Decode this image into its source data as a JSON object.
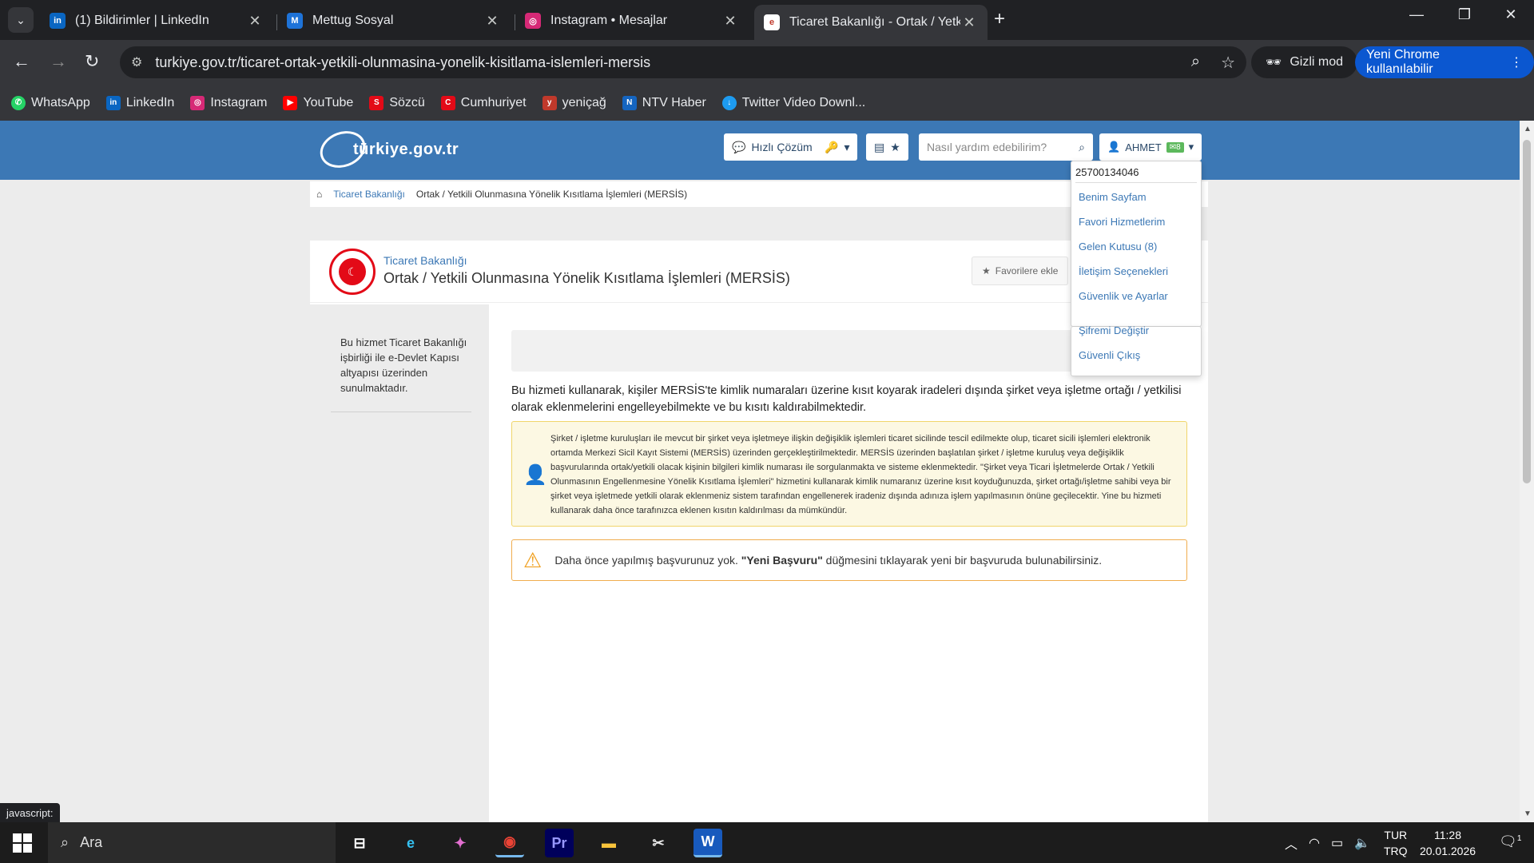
{
  "tabs": [
    {
      "title": "(1) Bildirimler | LinkedIn",
      "icon": "linkedin-icon",
      "color": "#0a66c2"
    },
    {
      "title": "Mettug Sosyal",
      "icon": "mettug-icon",
      "color": "#1e73d8"
    },
    {
      "title": "Instagram • Mesajlar",
      "icon": "instagram-icon",
      "color": "#d62976"
    },
    {
      "title": "Ticaret Bakanlığı - Ortak / Yetkil",
      "icon": "turkiye-gov-icon",
      "color": "#c0392b"
    }
  ],
  "address_bar": {
    "url": "turkiye.gov.tr/ticaret-ortak-yetkili-olunmasina-yonelik-kisitlama-islemleri-mersis"
  },
  "incognito_label": "Gizli mod",
  "new_chrome_label": "Yeni Chrome kullanılabilir",
  "bookmarks": [
    {
      "label": "WhatsApp",
      "color": "#25d366"
    },
    {
      "label": "LinkedIn",
      "color": "#0a66c2"
    },
    {
      "label": "Instagram",
      "color": "#d62976"
    },
    {
      "label": "YouTube",
      "color": "#ff0000"
    },
    {
      "label": "Sözcü",
      "color": "#e30a17"
    },
    {
      "label": "Cumhuriyet",
      "color": "#e30a17"
    },
    {
      "label": "yeniçağ",
      "color": "#c0392b"
    },
    {
      "label": "NTV Haber",
      "color": "#1565c0"
    },
    {
      "label": "Twitter Video Downl...",
      "color": "#1d9bf0"
    }
  ],
  "site": {
    "logo_text": "türkiye.gov.tr",
    "quick_solution": "Hızlı Çözüm",
    "search_placeholder": "Nasıl yardım edebilirim?",
    "user_name": "AHMET",
    "mail_count": "8"
  },
  "breadcrumb": {
    "home": "home",
    "items": [
      "Ticaret Bakanlığı",
      "Ortak / Yetkili Olunmasına Yönelik Kısıtlama İşlemleri (MERSİS)"
    ]
  },
  "service": {
    "agency": "Ticaret Bakanlığı",
    "title": "Ortak / Yetkili Olunmasına Yönelik Kısıtlama İşlemleri (MERSİS)",
    "favorite_label": "Favorilere ekle"
  },
  "sidebar_note": "Bu hizmet Ticaret Bakanlığı işbirliği ile e-Devlet Kapısı altyapısı üzerinden sunulmaktadır.",
  "intro_text": "Bu hizmeti kullanarak, kişiler MERSİS'te kimlik numaraları üzerine kısıt koyarak iradeleri dışında şirket veya işletme ortağı / yetkilisi olarak eklenmelerini engelleyebilmekte ve bu kısıtı kaldırabilmektedir.",
  "info_text": "Şirket / işletme kuruluşları ile mevcut bir şirket veya işletmeye ilişkin değişiklik işlemleri ticaret sicilinde tescil edilmekte olup, ticaret sicili işlemleri elektronik ortamda Merkezi Sicil Kayıt Sistemi (MERSİS) üzerinden gerçekleştirilmektedir. MERSİS üzerinden başlatılan şirket / işletme kuruluş veya değişiklik başvurularında ortak/yetkili olacak kişinin bilgileri kimlik numarası ile sorgulanmakta ve sisteme eklenmektedir. \"Şirket veya Ticari İşletmelerde Ortak / Yetkili Olunmasının Engellenmesine Yönelik Kısıtlama İşlemleri\" hizmetini kullanarak kimlik numaranız üzerine kısıt koyduğunuzda, şirket ortağı/işletme sahibi veya bir şirket veya işletmede yetkili olarak eklenmeniz sistem tarafından engellenerek iradeniz dışında adınıza işlem yapılmasının önüne geçilecektir. Yine bu hizmeti kullanarak daha önce tarafınızca eklenen kısıtın kaldırılması da mümkündür.",
  "warning": {
    "before": "Daha önce yapılmış başvurunuz yok. ",
    "strong": "\"Yeni Başvuru\"",
    "after": " düğmesini tıklayarak yeni bir başvuruda bulunabilirsiniz."
  },
  "user_menu": {
    "tc_no": "25700134046",
    "items": [
      "Benim Sayfam",
      "Favori Hizmetlerim",
      "Gelen Kutusu (8)",
      "İletişim Seçenekleri",
      "Güvenlik ve Ayarlar",
      "Şifremi Değiştir",
      "Güvenli Çıkış"
    ]
  },
  "status_bar": "javascript:",
  "taskbar": {
    "search_label": "Ara",
    "lang_line1": "TUR",
    "lang_line2": "TRQ",
    "time": "11:28",
    "date": "20.01.2026",
    "notif_count": "1"
  }
}
